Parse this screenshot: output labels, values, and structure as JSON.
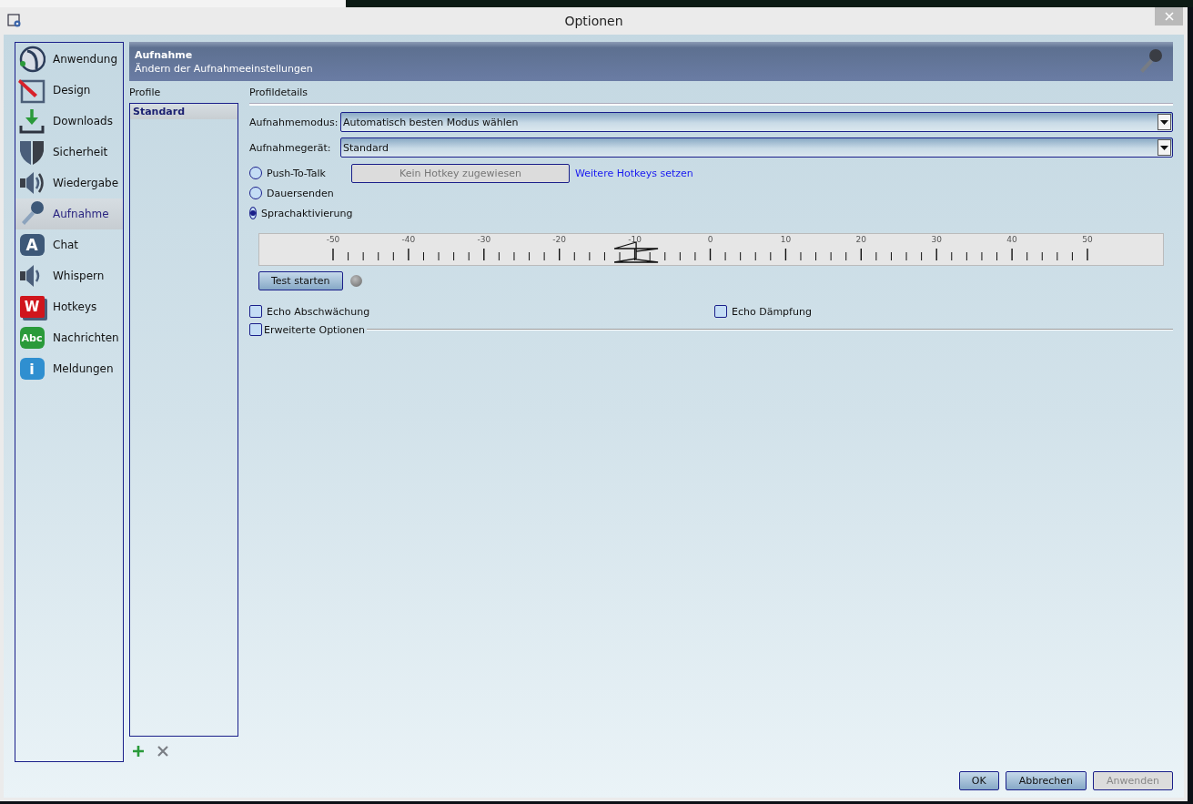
{
  "window": {
    "title": "Optionen"
  },
  "sidebar": {
    "items": [
      {
        "kind": "app",
        "label": "Anwendung",
        "selected": false
      },
      {
        "kind": "design",
        "label": "Design",
        "selected": false
      },
      {
        "kind": "download",
        "label": "Downloads",
        "selected": false
      },
      {
        "kind": "shield",
        "label": "Sicherheit",
        "selected": false
      },
      {
        "kind": "speaker",
        "label": "Wiedergabe",
        "selected": false
      },
      {
        "kind": "mic",
        "label": "Aufnahme",
        "selected": true
      },
      {
        "kind": "chat",
        "label": "Chat",
        "icon_text": "A",
        "selected": false
      },
      {
        "kind": "whisper",
        "label": "Whispern",
        "selected": false
      },
      {
        "kind": "hotkey",
        "label": "Hotkeys",
        "icon_text": "W",
        "selected": false
      },
      {
        "kind": "message",
        "label": "Nachrichten",
        "icon_text": "Abc",
        "selected": false
      },
      {
        "kind": "info",
        "label": "Meldungen",
        "icon_text": "i",
        "selected": false
      }
    ]
  },
  "header": {
    "title": "Aufnahme",
    "subtitle": "Ändern der Aufnahmeeinstellungen"
  },
  "profiles": {
    "heading": "Profile",
    "items": [
      {
        "label": "Standard",
        "selected": true
      }
    ]
  },
  "details": {
    "heading": "Profildetails",
    "fields": [
      {
        "label": "Aufnahmemodus:",
        "value": "Automatisch besten Modus wählen"
      },
      {
        "label": "Aufnahmegerät:",
        "value": "Standard"
      }
    ],
    "modes": [
      {
        "label": "Push-To-Talk",
        "selected": false
      },
      {
        "label": "Dauersenden",
        "selected": false
      },
      {
        "label": "Sprachaktivierung",
        "selected": true
      }
    ],
    "hotkey_button": "Kein Hotkey zugewiesen",
    "hotkeys_link": "Weitere Hotkeys setzen",
    "threshold": {
      "level": 0.417,
      "ticks": [
        "-50",
        "-40",
        "-30",
        "-20",
        "-10",
        "0",
        "10",
        "20",
        "30",
        "40",
        "50"
      ]
    },
    "test_button": "Test starten",
    "options": [
      {
        "label": "Echo Abschwächung",
        "checked": false
      },
      {
        "label": "Echo Dämpfung",
        "checked": false
      }
    ],
    "advanced": {
      "label": "Erweiterte Optionen",
      "checked": false
    }
  },
  "buttons": [
    {
      "label": "OK",
      "disabled": false
    },
    {
      "label": "Abbrechen",
      "disabled": false
    },
    {
      "label": "Anwenden",
      "disabled": true
    }
  ]
}
